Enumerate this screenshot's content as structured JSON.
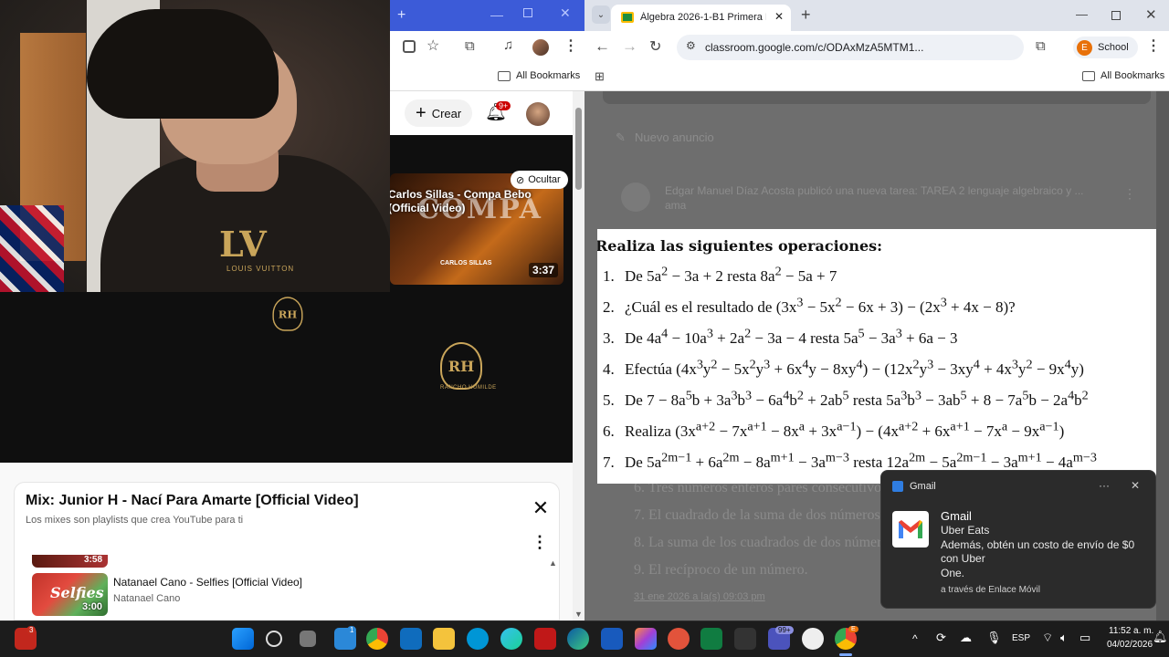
{
  "left_window": {
    "bookmarks_label": "All Bookmarks",
    "youtube": {
      "create_label": "Crear",
      "notif_count": "9+",
      "video_card": {
        "title": "Carlos Sillas - Compa Bebo (Official Video)",
        "artist": "CARLOS SILLAS",
        "duration": "3:37",
        "overlay_word": "COMPA",
        "hide_label": "Ocultar"
      },
      "player_logo": "RH",
      "player_logo_sub": "RANCHO HUMILDE",
      "playlist": {
        "title": "Mix: Junior H - Nací Para Amarte [Official Video]",
        "subtitle": "Los mixes son playlists que crea YouTube para ti",
        "prev_duration": "3:58",
        "item": {
          "title": "Natanael Cano - Selfies [Official Video]",
          "channel": "Natanael Cano",
          "duration": "3:00",
          "thumb_text": "Selfies"
        }
      }
    },
    "webcam": {
      "shirt_logo": "LV",
      "shirt_logo_sub": "LOUIS VUITTON"
    }
  },
  "right_window": {
    "tab_title": "Álgebra 2026-1-B1 Primera Hor",
    "url": "classroom.google.com/c/ODAxMzA5MTM1...",
    "profile_initial": "E",
    "profile_label": "School",
    "bookmarks_label": "All Bookmarks",
    "classroom": {
      "new_announcement": "Nuevo anuncio",
      "post_text": "Edgar Manuel Díaz Acosta publicó una nueva tarea: TAREA 2 lenguaje algebraico y ...",
      "post_text_line2": "ama",
      "worksheet_heading": "Realiza las siguientes operaciones:",
      "exercises": [
        {
          "num": "1.",
          "html": "De 5a<sup>2</sup> − 3a + 2 resta 8a<sup>2</sup> − 5a + 7"
        },
        {
          "num": "2.",
          "html": "¿Cuál es el resultado de (3x<sup>3</sup> − 5x<sup>2</sup> − 6x + 3) − (2x<sup>3</sup> + 4x − 8)?"
        },
        {
          "num": "3.",
          "html": "De 4a<sup>4</sup> − 10a<sup>3</sup> + 2a<sup>2</sup> − 3a − 4 resta 5a<sup>5</sup> − 3a<sup>3</sup> + 6a − 3"
        },
        {
          "num": "4.",
          "html": "Efectúa (4x<sup>3</sup>y<sup>2</sup> − 5x<sup>2</sup>y<sup>3</sup> + 6x<sup>4</sup>y − 8xy<sup>4</sup>) − (12x<sup>2</sup>y<sup>3</sup> − 3xy<sup>4</sup> + 4x<sup>3</sup>y<sup>2</sup> − 9x<sup>4</sup>y)"
        },
        {
          "num": "5.",
          "html": "De 7 − 8a<sup>5</sup>b + 3a<sup>3</sup>b<sup>3</sup> − 6a<sup>4</sup>b<sup>2</sup> + 2ab<sup>5</sup> resta 5a<sup>3</sup>b<sup>3</sup> − 3ab<sup>5</sup> + 8 − 7a<sup>5</sup>b − 2a<sup>4</sup>b<sup>2</sup>"
        },
        {
          "num": "6.",
          "html": "Realiza (3x<sup>a+2</sup> − 7x<sup>a+1</sup> − 8x<sup>a</sup> + 3x<sup>a−1</sup>) − (4x<sup>a+2</sup> + 6x<sup>a+1</sup> − 7x<sup>a</sup> − 9x<sup>a−1</sup>)"
        },
        {
          "num": "7.",
          "html": "De 5a<sup>2m−1</sup> + 6a<sup>2m</sup> − 8a<sup>m+1</sup> − 3a<sup>m−3</sup> resta 12a<sup>2m</sup> − 5a<sup>2m−1</sup> − 3a<sup>m+1</sup> − 4a<sup>m−3</sup>"
        }
      ],
      "bg_lines": [
        "6.  Tres números enteros pares consecutivos.",
        "7.  El cuadrado de la suma de dos números.",
        "8.  La suma de los cuadrados de dos números.",
        "9.  El recíproco de un número."
      ],
      "date_line": "31 ene 2026 a la(s) 09:03 pm"
    },
    "gmail_toast": {
      "app": "Gmail",
      "heading": "Gmail",
      "line1": "Uber Eats",
      "line2": "Además, obtén un costo de envío de $0",
      "line3": "con Uber",
      "line4": "One.",
      "via": "a través de Enlace Móvil"
    }
  },
  "taskbar": {
    "left_badge": "3",
    "store_badge": "1",
    "teams_badge": "99+",
    "profile_badge": "E",
    "language": "ESP",
    "time": "11:52 a. m.",
    "date": "04/02/2026"
  },
  "colors": {
    "left_tabbar": "#3c5bd8",
    "right_tabbar": "#dfe3eb",
    "profile_orange": "#e8710a",
    "yt_red": "#ff0000"
  }
}
